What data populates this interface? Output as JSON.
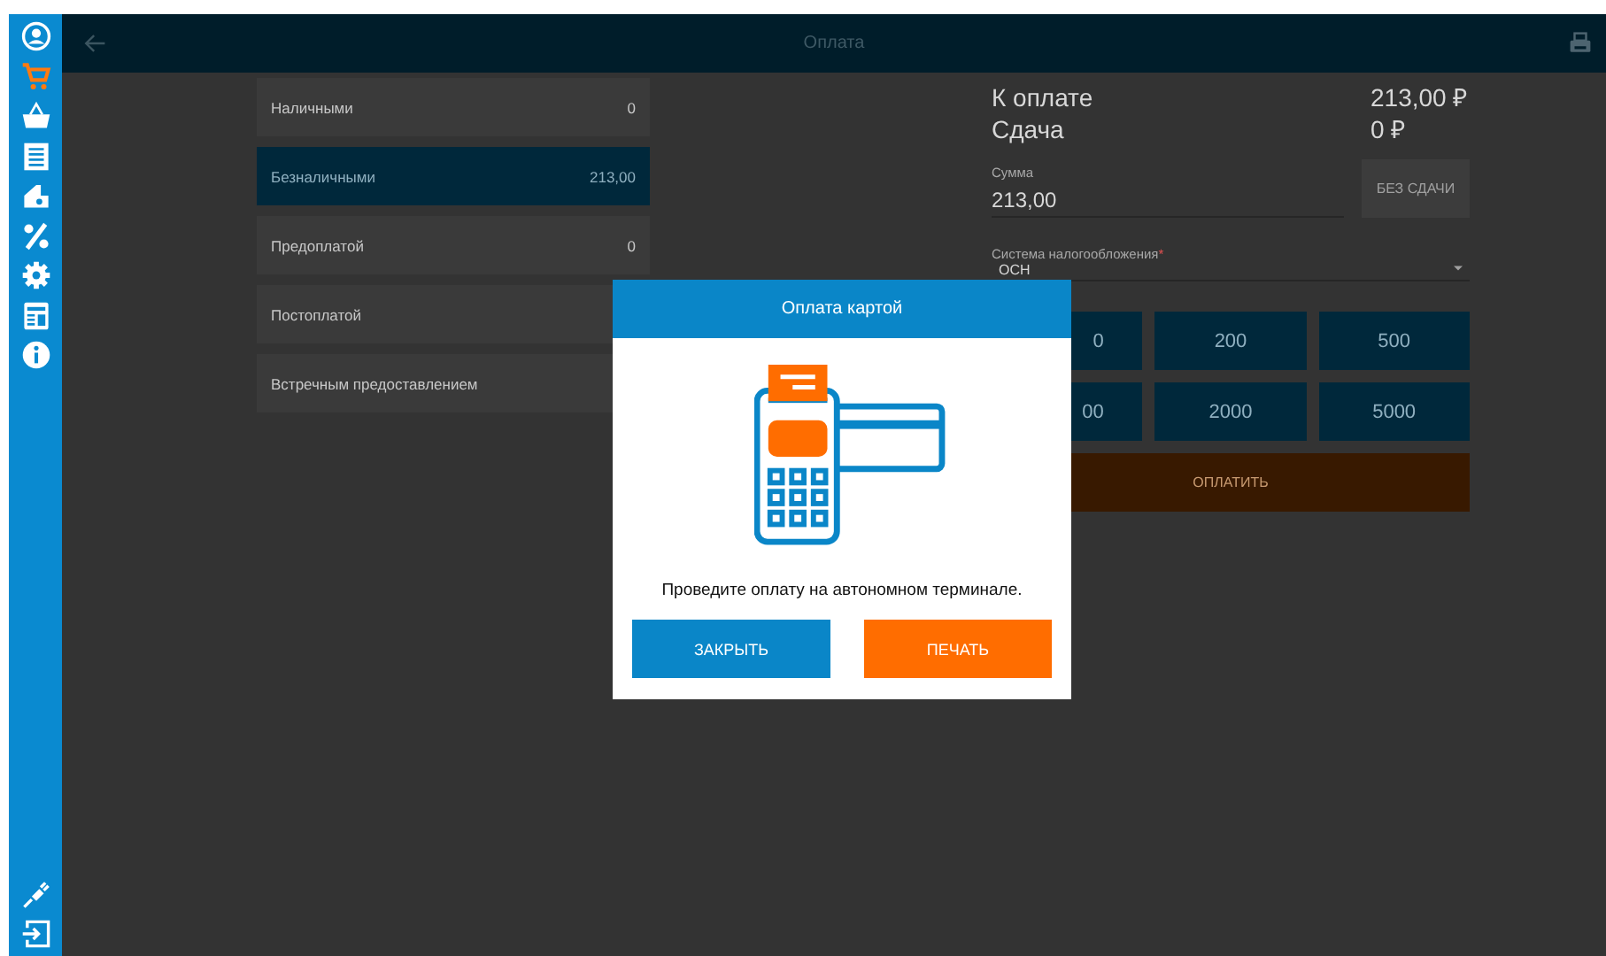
{
  "sidebar": {
    "items": [
      {
        "kind": "user",
        "selected": false
      },
      {
        "kind": "cart",
        "selected": true
      },
      {
        "kind": "basket",
        "selected": false
      },
      {
        "kind": "list",
        "selected": false
      },
      {
        "kind": "cashbox",
        "selected": false
      },
      {
        "kind": "percent",
        "selected": false
      },
      {
        "kind": "settings",
        "selected": false
      },
      {
        "kind": "report",
        "selected": false
      },
      {
        "kind": "info",
        "selected": false
      }
    ],
    "bottom_items": [
      {
        "kind": "plug",
        "selected": false
      },
      {
        "kind": "exit",
        "selected": false
      }
    ]
  },
  "header": {
    "title": "Оплата"
  },
  "payment_methods": [
    {
      "label": "Наличными",
      "amount": "0",
      "selected": false
    },
    {
      "label": "Безналичными",
      "amount": "213,00",
      "selected": true
    },
    {
      "label": "Предоплатой",
      "amount": "0",
      "selected": false
    },
    {
      "label": "Постоплатой",
      "selected": false
    },
    {
      "label": "Встречным предоставлением",
      "selected": false
    }
  ],
  "summary": [
    {
      "label": "К оплате",
      "value": "213,00 ₽"
    },
    {
      "label": "Сдача",
      "value": "0 ₽"
    }
  ],
  "amount_field": {
    "label": "Сумма",
    "value": "213,00"
  },
  "no_change_button": {
    "label": "БЕЗ СДАЧИ",
    "disabled": true
  },
  "tax_select": {
    "label": "Система налогообложения",
    "required_mark": "*",
    "value": "ОСН"
  },
  "quick_amounts": [
    {
      "label": "0",
      "covered": true
    },
    {
      "label": "200",
      "covered": false
    },
    {
      "label": "500",
      "covered": false
    },
    {
      "label": "00",
      "covered": true
    },
    {
      "label": "2000",
      "covered": false
    },
    {
      "label": "5000",
      "covered": false
    }
  ],
  "pay_button": {
    "label": "ОПЛАТИТЬ"
  },
  "dialog": {
    "title": "Оплата картой",
    "message": "Проведите оплату на автономном терминале.",
    "buttons": [
      {
        "label": "ЗАКРЫТЬ",
        "kind": "secondary"
      },
      {
        "label": "ПЕЧАТЬ",
        "kind": "primary"
      }
    ]
  }
}
